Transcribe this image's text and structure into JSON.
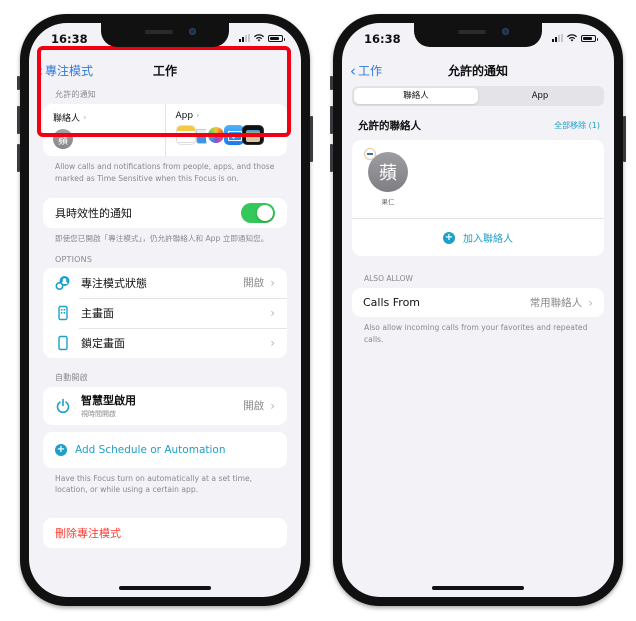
{
  "left_screen": {
    "status_bar": {
      "time": "16:38"
    },
    "nav": {
      "back_label": "專注模式",
      "title": "工作"
    },
    "allowed_notifications": {
      "section_header": "允許的通知",
      "people_label": "聯絡人",
      "people_avatar_initial": "蘋",
      "apps_label": "App",
      "app_icons": [
        "notes-app-icon",
        "water-cup-app-icon",
        "photos-app-icon",
        "mail-app-icon",
        "wallet-app-icon"
      ],
      "footer": "Allow calls and notifications from people, apps, and those marked as Time Sensitive when this Focus is on."
    },
    "time_sensitive": {
      "label": "具時效性的通知",
      "toggle_on": true,
      "footer": "即使您已開啟「專注模式」，仍允許聯絡人和 App 立即通知您。"
    },
    "options": {
      "section_header": "OPTIONS",
      "rows": [
        {
          "icon": "focus-status-icon",
          "label": "專注模式狀態",
          "value": "開啟"
        },
        {
          "icon": "home-screen-icon",
          "label": "主畫面",
          "value": ""
        },
        {
          "icon": "lock-screen-icon",
          "label": "鎖定畫面",
          "value": ""
        }
      ]
    },
    "auto_on": {
      "section_header": "自動開啟",
      "smart_label": "智慧型啟用",
      "smart_sub": "視時間開啟",
      "smart_value": "開啟",
      "add_label": "Add Schedule or Automation",
      "footer": "Have this Focus turn on automatically at a set time, location, or while using a certain app."
    },
    "delete_label": "刪除專注模式"
  },
  "right_screen": {
    "status_bar": {
      "time": "16:38"
    },
    "nav": {
      "back_label": "工作",
      "title": "允許的通知"
    },
    "segments": [
      {
        "label": "聯絡人",
        "active": true
      },
      {
        "label": "App",
        "active": false
      }
    ],
    "allowed_people": {
      "title": "允許的聯絡人",
      "remove_all_label": "全部移除 (1)",
      "contacts": [
        {
          "initial": "蘋",
          "name": "果仁"
        }
      ],
      "add_label": "加入聯絡人"
    },
    "also_allow": {
      "section_header": "ALSO ALLOW",
      "calls_label": "Calls From",
      "calls_value": "常用聯絡人",
      "footer": "Also allow incoming calls from your favorites and repeated calls."
    }
  },
  "colors": {
    "accent_blue": "#2f7bdc",
    "accent_teal": "#1c9fc8",
    "toggle_green": "#34c759",
    "destructive_red": "#ff3b30",
    "highlight_red": "#f00012",
    "grouped_background": "#f2f2f7"
  }
}
